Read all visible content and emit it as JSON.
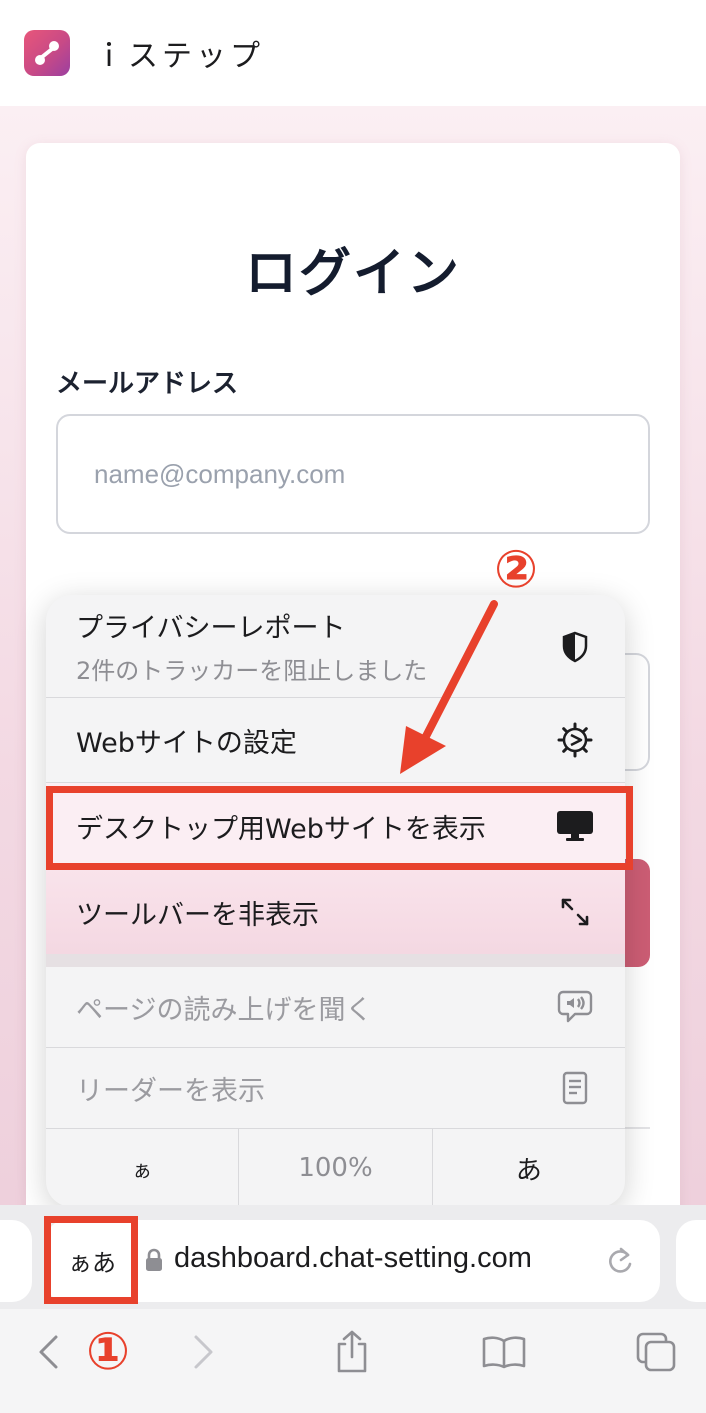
{
  "app": {
    "name": "ｉステップ"
  },
  "login": {
    "title": "ログイン",
    "email_label": "メールアドレス",
    "email_placeholder": "name@company.com"
  },
  "menu": {
    "privacy": {
      "label": "プライバシーレポート",
      "sub": "2件のトラッカーを阻止しました"
    },
    "website_settings": "Webサイトの設定",
    "desktop_site": "デスクトップ用Webサイトを表示",
    "hide_toolbar": "ツールバーを非表示",
    "listen": "ページの読み上げを聞く",
    "reader": "リーダーを表示",
    "zoom": {
      "smaller": "ぁ",
      "level": "100%",
      "larger": "あ"
    }
  },
  "annotations": {
    "step1": "①",
    "step2": "②",
    "color": "#e8412c"
  },
  "browser": {
    "aa_label": "ぁあ",
    "url": "dashboard.chat-setting.com"
  },
  "icons": {
    "privacy": "shield-icon",
    "settings": "gear-icon",
    "desktop": "monitor-icon",
    "toolbar": "expand-arrows-icon",
    "listen": "speaker-bubble-icon",
    "reader": "document-icon",
    "lock": "lock-icon",
    "reload": "reload-icon",
    "back": "chevron-left-icon",
    "forward": "chevron-right-icon",
    "share": "share-icon",
    "bookmarks": "book-icon",
    "tabs": "tabs-icon"
  }
}
